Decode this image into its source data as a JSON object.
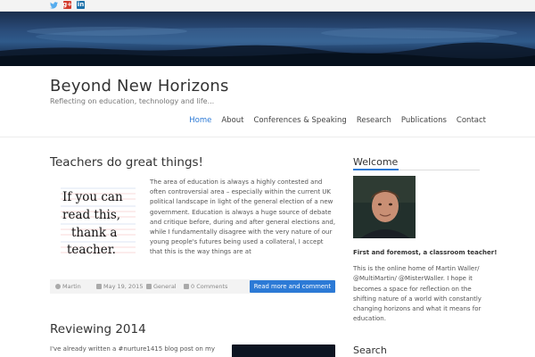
{
  "social": {
    "twitter_icon": "twitter-icon",
    "gplus_label": "g+",
    "linkedin_label": "in"
  },
  "site": {
    "title": "Beyond New Horizons",
    "tagline": "Reflecting on education, technology and life..."
  },
  "nav": {
    "items": [
      "Home",
      "About",
      "Conferences & Speaking",
      "Research",
      "Publications",
      "Contact"
    ],
    "active_index": 0
  },
  "post": {
    "title": "Teachers do great things!",
    "image_lines": [
      "If you can",
      "read this,",
      "thank a",
      "teacher."
    ],
    "excerpt": "The area of education is always a highly contested and often controversial area – especially within the current UK political landscape in light of the general election of a new government. Education is always a huge source of debate and critique before, during and after general elections and, while I fundamentally disagree with the very nature of our young people's futures being used a collateral, I accept that this is the way things are at",
    "meta": {
      "author": "Martin",
      "date": "May 19, 2015",
      "category": "General",
      "comments": "0 Comments"
    },
    "read_more": "Read more and comment"
  },
  "post2": {
    "title": "Reviewing 2014",
    "excerpt": "I've already written a #nurture1415 blog post on my"
  },
  "sidebar": {
    "welcome_title": "Welcome",
    "welcome_bold": "First and foremost, a classroom teacher!",
    "welcome_text": "This is the online home of Martin Waller/ @MultiMartin/ @MisterWaller. I hope it becomes a space for reflection on the shifting nature of a world with constantly changing horizons and what it means for education.",
    "search_title": "Search"
  },
  "colors": {
    "accent": "#2c7ad6",
    "google_plus": "#d23a2c",
    "linkedin": "#1a6fa8",
    "twitter": "#55acee"
  }
}
